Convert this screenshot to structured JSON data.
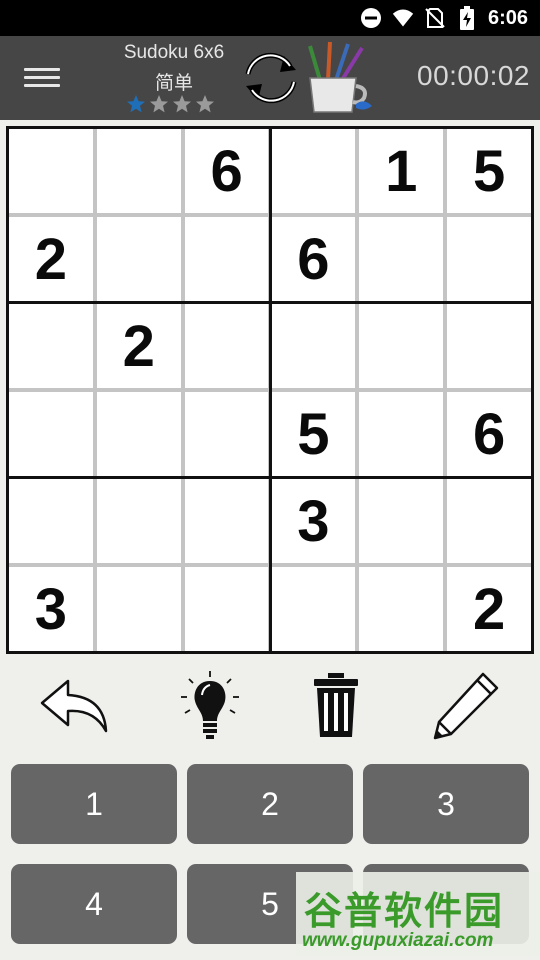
{
  "status_bar": {
    "time": "6:06",
    "icons": [
      "do-not-disturb-icon",
      "wifi-icon",
      "no-sim-icon",
      "battery-charging-icon"
    ]
  },
  "header": {
    "title": "Sudoku 6x6",
    "difficulty": "简单",
    "stars_total": 4,
    "stars_filled": 1,
    "timer": "00:00:02",
    "icons": [
      "menu-icon",
      "refresh-icon",
      "brush-cup-icon"
    ]
  },
  "board": {
    "rows": [
      [
        "",
        "",
        "6",
        "",
        "1",
        "5"
      ],
      [
        "2",
        "",
        "",
        "6",
        "",
        ""
      ],
      [
        "",
        "2",
        "",
        "",
        "",
        ""
      ],
      [
        "",
        "",
        "",
        "5",
        "",
        "6"
      ],
      [
        "",
        "",
        "",
        "3",
        "",
        ""
      ],
      [
        "3",
        "",
        "",
        "",
        "",
        "2"
      ]
    ]
  },
  "tools": [
    "undo-icon",
    "hint-bulb-icon",
    "trash-icon",
    "pencil-icon"
  ],
  "numpad": [
    "1",
    "2",
    "3",
    "4",
    "5"
  ],
  "watermark": {
    "text": "谷普软件园",
    "url": "www.gupuxiazai.com"
  },
  "colors": {
    "appbar": "#464646",
    "star_filled": "#1e6fb8",
    "star_empty": "#9a9a9a",
    "numpad_button": "#666666",
    "watermark": "#3a9a2a"
  }
}
